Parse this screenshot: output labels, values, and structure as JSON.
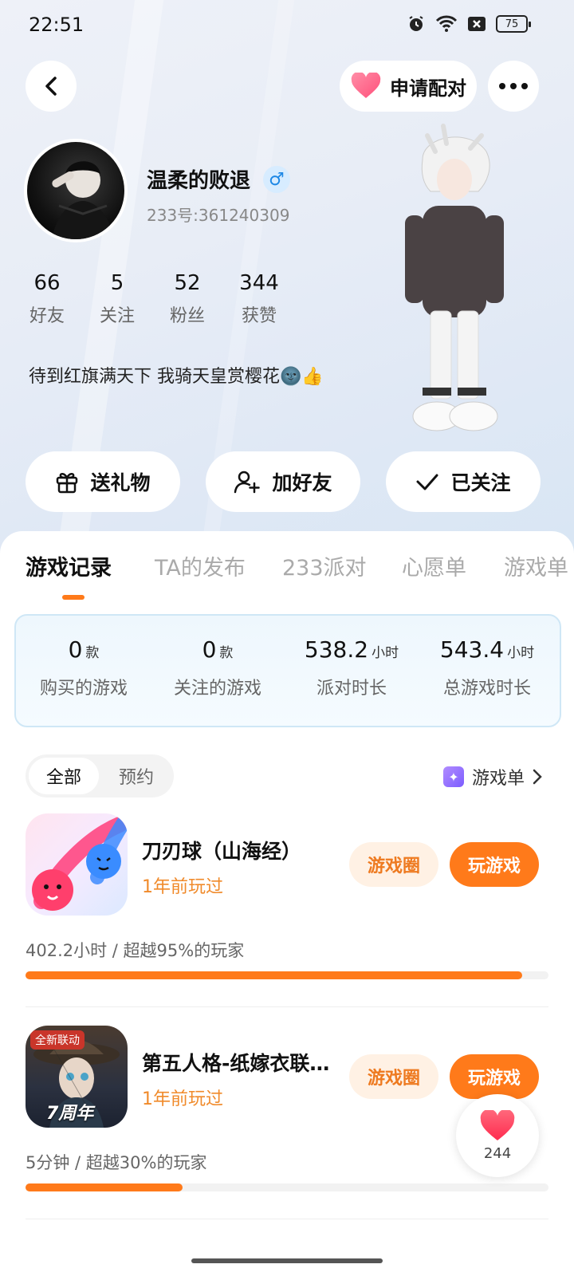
{
  "status_bar": {
    "time": "22:51",
    "battery": "75"
  },
  "header": {
    "pair_label": "申请配对"
  },
  "profile": {
    "name": "温柔的败退",
    "gender_symbol": "♂",
    "uid": "233号:361240309",
    "bio": "待到红旗满天下 我骑天皇赏樱花🌚👍"
  },
  "stats": [
    {
      "value": "66",
      "label": "好友"
    },
    {
      "value": "5",
      "label": "关注"
    },
    {
      "value": "52",
      "label": "粉丝"
    },
    {
      "value": "344",
      "label": "获赞"
    }
  ],
  "actions": {
    "gift": "送礼物",
    "add_friend": "加好友",
    "followed": "已关注"
  },
  "tabs": [
    "游戏记录",
    "TA的发布",
    "233派对",
    "心愿单",
    "游戏单"
  ],
  "summary": [
    {
      "value": "0",
      "unit": "款",
      "label": "购买的游戏"
    },
    {
      "value": "0",
      "unit": "款",
      "label": "关注的游戏"
    },
    {
      "value": "538.2",
      "unit": "小时",
      "label": "派对时长"
    },
    {
      "value": "543.4",
      "unit": "小时",
      "label": "总游戏时长"
    }
  ],
  "filter": {
    "all": "全部",
    "reserve": "预约"
  },
  "game_list_link": "游戏单",
  "games": [
    {
      "title": "刀刃球（山海经）",
      "last_played": "1年前玩过",
      "circle_label": "游戏圈",
      "play_label": "玩游戏",
      "stat": "402.2小时 / 超越95%的玩家",
      "progress": 0.95
    },
    {
      "title": "第五人格-纸嫁衣联…",
      "last_played": "1年前玩过",
      "circle_label": "游戏圈",
      "play_label": "玩游戏",
      "stat": "5分钟 / 超越30%的玩家",
      "progress": 0.3,
      "icon_badge": "全新联动",
      "icon_text": "7周年"
    }
  ],
  "like_count": "244",
  "colors": {
    "accent": "#ff7a1a",
    "accent_light": "#fff1e4"
  }
}
